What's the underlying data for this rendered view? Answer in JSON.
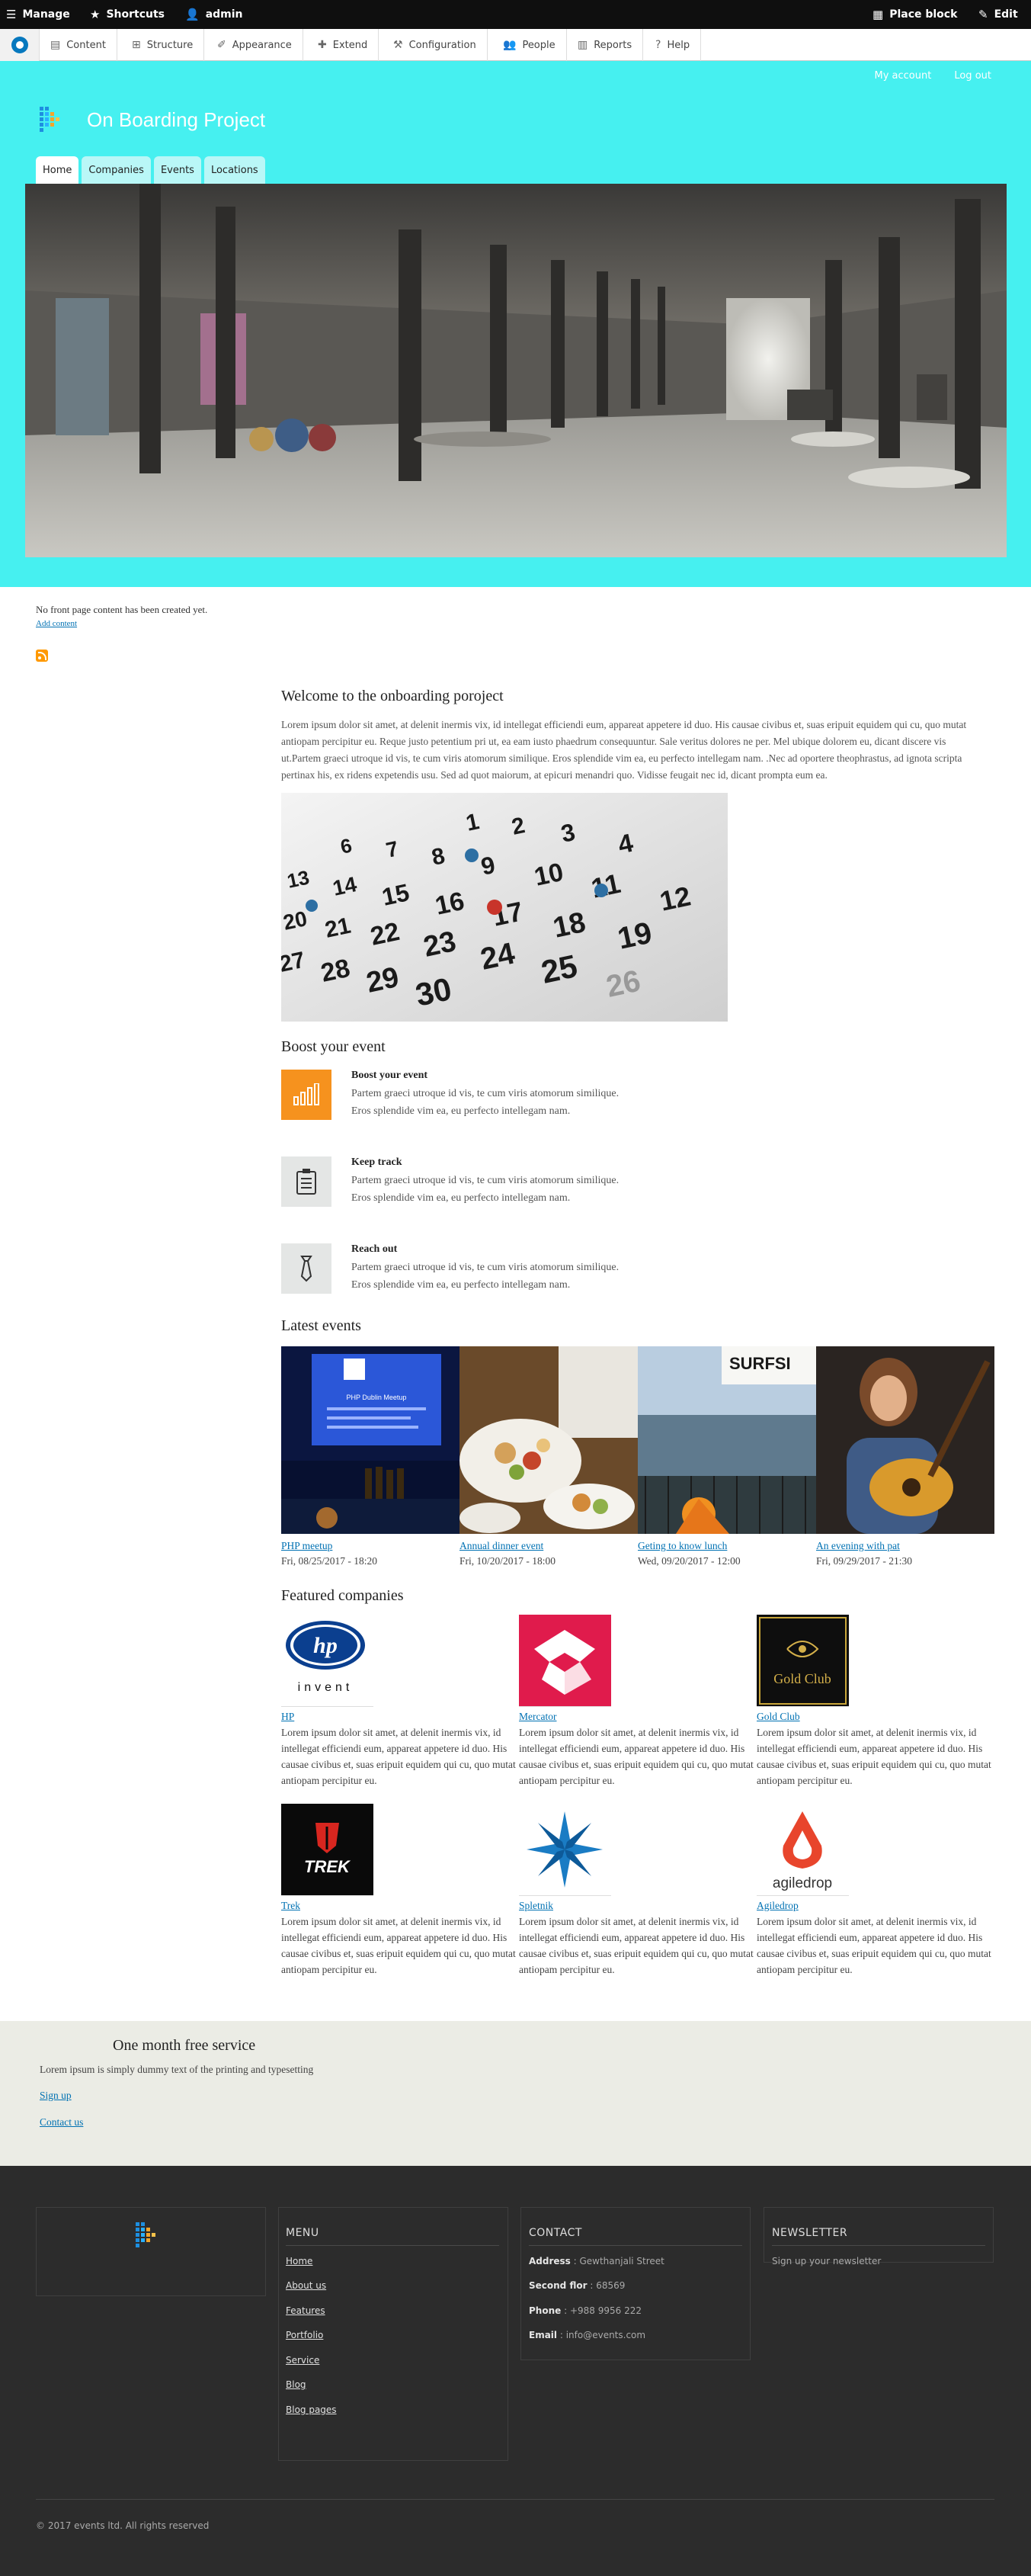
{
  "admin_toolbar": {
    "manage": "Manage",
    "shortcuts": "Shortcuts",
    "user": "admin",
    "place_block": "Place block",
    "edit": "Edit"
  },
  "admin_tray": {
    "items": [
      "Content",
      "Structure",
      "Appearance",
      "Extend",
      "Configuration",
      "People",
      "Reports",
      "Help"
    ]
  },
  "header": {
    "secondary_menu": [
      "My account",
      "Log out"
    ],
    "site_name": "On Boarding Project",
    "tabs": [
      "Home",
      "Companies",
      "Events",
      "Locations"
    ],
    "active_tab": "Home",
    "accent_color": "#46f0f0"
  },
  "main": {
    "no_front": "No front page content has been created yet.",
    "add_content": "Add content",
    "welcome_title": "Welcome to the onboarding poroject",
    "welcome_text": "Lorem ipsum dolor sit amet, at delenit inermis vix, id intellegat efficiendi eum, appareat appetere id duo. His causae civibus et, suas eripuit equidem qui cu, quo mutat antiopam percipitur eu. Reque justo petentium pri ut, ea eam iusto phaedrum consequuntur. Sale veritus dolores ne per. Mel ubique dolorem eu, dicant discere vis ut.Partem graeci utroque id vis, te cum viris atomorum similique. Eros splendide vim ea, eu perfecto intellegam nam. .Nec ad oportere theophrastus, ad ignota scripta pertinax his, ex ridens expetendis usu. Sed ad quot maiorum, at epicuri menandri quo. Vidisse feugait nec id, dicant prompta eum ea.",
    "calendar_numbers": [
      "1",
      "2",
      "3",
      "4",
      "6",
      "7",
      "8",
      "9",
      "10",
      "11",
      "12",
      "13",
      "14",
      "15",
      "16",
      "17",
      "18",
      "19",
      "20",
      "21",
      "22",
      "23",
      "24",
      "25",
      "26",
      "27",
      "28",
      "29",
      "30"
    ],
    "boost_title": "Boost your event",
    "features": [
      {
        "icon": "bar-chart-icon",
        "title": "Boost your event",
        "line1": "Partem graeci utroque id vis, te cum viris atomorum similique.",
        "line2": "Eros splendide vim ea, eu perfecto intellegam nam."
      },
      {
        "icon": "clipboard-icon",
        "title": "Keep track",
        "line1": "Partem graeci utroque id vis, te cum viris atomorum similique.",
        "line2": "Eros splendide vim ea, eu perfecto intellegam nam."
      },
      {
        "icon": "tie-icon",
        "title": "Reach out",
        "line1": "Partem graeci utroque id vis, te cum viris atomorum similique.",
        "line2": "Eros splendide vim ea, eu perfecto intellegam nam."
      }
    ],
    "latest_title": "Latest events",
    "events": [
      {
        "title": "PHP meetup",
        "date": "Fri, 08/25/2017 - 18:20",
        "screen_text": "PHP Dublin Meetup"
      },
      {
        "title": "Annual dinner event",
        "date": "Fri, 10/20/2017 - 18:00"
      },
      {
        "title": "Geting to know lunch",
        "date": "Wed, 09/20/2017 - 12:00",
        "sign_text": "SURFSI"
      },
      {
        "title": "An evening with pat",
        "date": "Fri, 09/29/2017 - 21:30"
      }
    ],
    "featured_title": "Featured companies",
    "companies": [
      {
        "name": "HP",
        "logo_text": "hp",
        "logo_tagline": "invent",
        "text": "Lorem ipsum dolor sit amet, at delenit inermis vix, id intellegat efficiendi eum, appareat appetere id duo. His causae civibus et, suas eripuit equidem qui cu, quo mutat antiopam percipitur eu."
      },
      {
        "name": "Mercator",
        "text": "Lorem ipsum dolor sit amet, at delenit inermis vix, id intellegat efficiendi eum, appareat appetere id duo. His causae civibus et, suas eripuit equidem qui cu, quo mutat antiopam percipitur eu."
      },
      {
        "name": "Gold Club",
        "logo_text": "Gold Club",
        "text": "Lorem ipsum dolor sit amet, at delenit inermis vix, id intellegat efficiendi eum, appareat appetere id duo. His causae civibus et, suas eripuit equidem qui cu, quo mutat antiopam percipitur eu."
      },
      {
        "name": "Trek",
        "logo_text": "TREK",
        "text": "Lorem ipsum dolor sit amet, at delenit inermis vix, id intellegat efficiendi eum, appareat appetere id duo. His causae civibus et, suas eripuit equidem qui cu, quo mutat antiopam percipitur eu."
      },
      {
        "name": "Spletnik",
        "text": "Lorem ipsum dolor sit amet, at delenit inermis vix, id intellegat efficiendi eum, appareat appetere id duo. His causae civibus et, suas eripuit equidem qui cu, quo mutat antiopam percipitur eu."
      },
      {
        "name": "Agiledrop",
        "logo_text": "agiledrop",
        "text": "Lorem ipsum dolor sit amet, at delenit inermis vix, id intellegat efficiendi eum, appareat appetere id duo. His causae civibus et, suas eripuit equidem qui cu, quo mutat antiopam percipitur eu."
      }
    ]
  },
  "service": {
    "title": "One month free service",
    "text": "Lorem ipsum is simply dummy text of the printing and typesetting",
    "signup": "Sign up",
    "contact": "Contact us"
  },
  "footer": {
    "menu_title": "MENU",
    "menu_items": [
      "Home",
      "About us",
      "Features",
      "Portfolio",
      "Service",
      "Blog",
      "Blog pages"
    ],
    "contact_title": "CONTACT",
    "contact": [
      {
        "label": "Address",
        "value": "Gewthanjali Street"
      },
      {
        "label": "Second flor",
        "value": "68569"
      },
      {
        "label": "Phone",
        "value": "+988 9956 222"
      },
      {
        "label": "Email",
        "value": "info@events.com"
      }
    ],
    "newsletter_title": "NEWSLETTER",
    "newsletter_text": "Sign up your newsletter",
    "copyright": "© 2017 events ltd. All rights reserved"
  }
}
